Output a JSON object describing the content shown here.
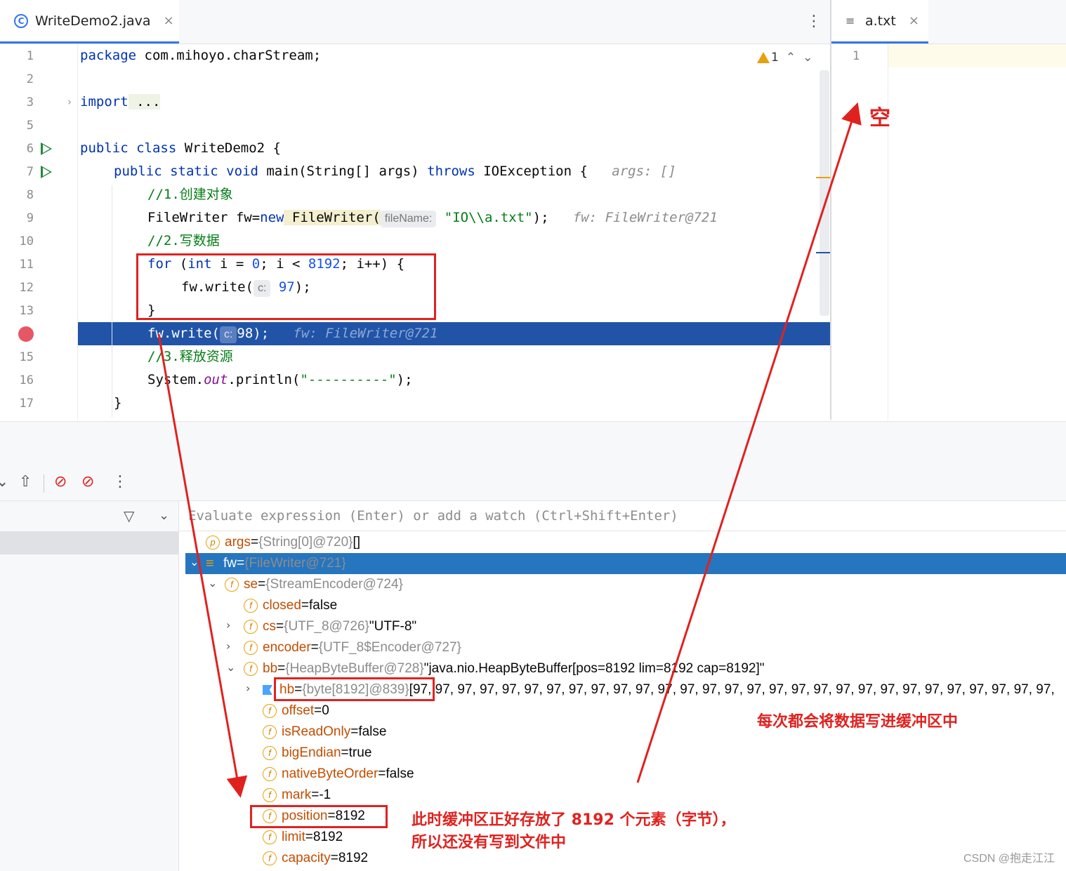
{
  "editor": {
    "tab_label": "WriteDemo2.java",
    "tab_close": "×",
    "menu_icon": "⋮",
    "java_icon_letter": "C",
    "line_numbers": [
      "1",
      "2",
      "3",
      "5",
      "6",
      "7",
      "8",
      "9",
      "10",
      "11",
      "12",
      "13",
      "",
      "15",
      "16",
      "17"
    ],
    "warning_count": "1",
    "code": {
      "l1_kw": "package",
      "l1_rest": " com.mihoyo.charStream;",
      "l3_kw": "import",
      "l3_rest": " ...",
      "l6_kw": "public class",
      "l6_rest": " WriteDemo2 {",
      "l7_a": "public static void",
      "l7_b": " main(String[] args) ",
      "l7_c": "throws",
      "l7_d": " IOException {",
      "l7_hint": "args: []",
      "l8": "//1.创建对象",
      "l9_a": "FileWriter fw=",
      "l9_b": "new",
      "l9_c": " FileWriter(",
      "l9_hint": "fileName:",
      "l9_str": "\"IO\\\\a.txt\"",
      "l9_d": ");",
      "l9_dbg": "fw: FileWriter@721",
      "l10": "//2.写数据",
      "l11_a": "for",
      "l11_b": " (",
      "l11_c": "int",
      "l11_d": " i = ",
      "l11_e": "0",
      "l11_f": "; i < ",
      "l11_g": "8192",
      "l11_h": "; i++) {",
      "l12_a": "fw.write(",
      "l12_hint": "c:",
      "l12_num": "97",
      "l12_b": ");",
      "l13": "}",
      "l14_a": "fw.write(",
      "l14_hint": "c:",
      "l14_num": "98",
      "l14_b": ");",
      "l14_dbg": "fw: FileWriter@721",
      "l15": "//3.释放资源",
      "l16_a": "System.",
      "l16_field": "out",
      "l16_b": ".println(",
      "l16_str": "\"----------\"",
      "l16_c": ");",
      "l17": "}"
    }
  },
  "right_editor": {
    "tab_label": "a.txt",
    "tab_close": "×",
    "line_number": "1"
  },
  "debugger": {
    "evaluate_placeholder": "Evaluate expression (Enter) or add a watch (Ctrl+Shift+Enter)",
    "variables": [
      {
        "icon": "p",
        "name": "args",
        "type": "{String[0]@720}",
        "value": "[]"
      },
      {
        "icon": "≡",
        "name": "fw",
        "type": "{FileWriter@721}",
        "value": ""
      },
      {
        "icon": "f",
        "name": "se",
        "type": "{StreamEncoder@724}",
        "value": ""
      },
      {
        "icon": "f",
        "name": "closed",
        "type": "",
        "value": "false"
      },
      {
        "icon": "f",
        "name": "cs",
        "type": "{UTF_8@726}",
        "value": "\"UTF-8\""
      },
      {
        "icon": "f",
        "name": "encoder",
        "type": "{UTF_8$Encoder@727}",
        "value": ""
      },
      {
        "icon": "f",
        "name": "bb",
        "type": "{HeapByteBuffer@728}",
        "value": "\"java.nio.HeapByteBuffer[pos=8192 lim=8192 cap=8192]\""
      },
      {
        "icon": "",
        "name": "hb",
        "type": "{byte[8192]@839}",
        "value": "[97, 97, 97, 97, 97, 97, 97, 97, 97, 97, 97, 97, 97, 97, 97, 97, 97, 97, 97, 97, 97, 97, 97, 97, 97, 97, 97, 97, 97,"
      },
      {
        "icon": "f",
        "name": "offset",
        "type": "",
        "value": "0"
      },
      {
        "icon": "f",
        "name": "isReadOnly",
        "type": "",
        "value": "false"
      },
      {
        "icon": "f",
        "name": "bigEndian",
        "type": "",
        "value": "true"
      },
      {
        "icon": "f",
        "name": "nativeByteOrder",
        "type": "",
        "value": "false"
      },
      {
        "icon": "f",
        "name": "mark",
        "type": "",
        "value": "-1"
      },
      {
        "icon": "f",
        "name": "position",
        "type": "",
        "value": "8192"
      },
      {
        "icon": "f",
        "name": "limit",
        "type": "",
        "value": "8192"
      },
      {
        "icon": "f",
        "name": "capacity",
        "type": "",
        "value": "8192"
      }
    ]
  },
  "annotations": {
    "empty": "空",
    "buffer_write": "每次都会将数据写进缓冲区中",
    "buffer_full_1": "此时缓冲区正好存放了 8192 个元素（字节），",
    "buffer_full_2": "所以还没有写到文件中"
  },
  "watermark": "CSDN @抱走江江",
  "colors": {
    "annotation_red": "#e0221f",
    "selection_blue": "#2675bf",
    "exec_line": "#2154a6"
  }
}
